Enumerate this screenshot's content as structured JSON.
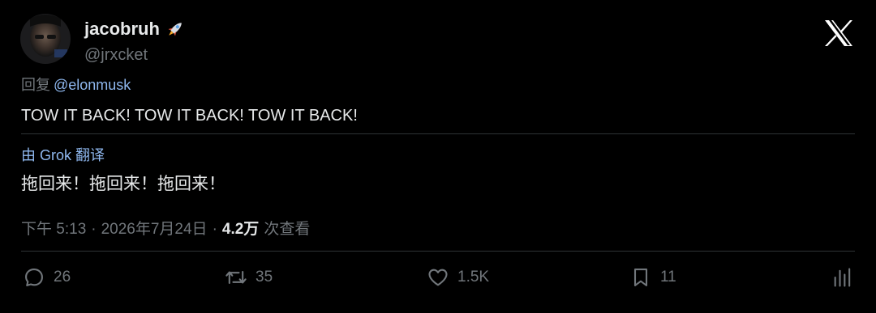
{
  "author": {
    "display_name": "jacobruh",
    "handle": "@jrxcket"
  },
  "reply": {
    "prefix": "回复",
    "mention": "@elonmusk"
  },
  "tweet": {
    "text": "TOW IT BACK! TOW IT BACK! TOW IT BACK!"
  },
  "translation": {
    "label": "由 Grok 翻译",
    "text": "拖回来！拖回来！拖回来！"
  },
  "meta": {
    "time": "下午 5:13",
    "separator": "·",
    "date": "2026年7月24日",
    "views_count": "4.2万",
    "views_label": "次查看"
  },
  "actions": {
    "replies": "26",
    "reposts": "35",
    "likes": "1.5K",
    "bookmarks": "11"
  },
  "icons": {
    "brand": "x-logo-icon",
    "badge": "rocket-icon",
    "reply": "reply-icon",
    "repost": "repost-icon",
    "like": "heart-icon",
    "bookmark": "bookmark-icon",
    "analytics": "analytics-icon"
  },
  "colors": {
    "background": "#000000",
    "text": "#e7e9ea",
    "muted": "#71767b",
    "link": "#8fb8ef",
    "divider": "#2f3336"
  }
}
